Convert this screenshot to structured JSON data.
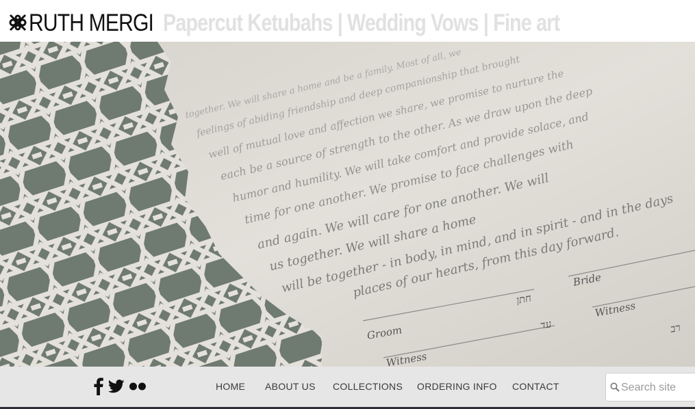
{
  "header": {
    "brand": "RUTH MERGI",
    "tagline": "Papercut Ketubahs | Wedding Vows | Fine art",
    "logo_icon": "ornament-logo-icon"
  },
  "hero": {
    "image": "papercut-ketubah-photo",
    "labels": {
      "groom": "Groom",
      "bride": "Bride",
      "witness1": "Witness",
      "witness2": "Witness",
      "heb_chatan": "חתן",
      "heb_ed": "עד",
      "heb_rav": "רב"
    },
    "text_lines": [
      "together. We will share a home and be a family. Most of all, we",
      "feelings of abiding friendship and deep companionship that brought",
      "well of mutual love and affection we share, we promise to nurture the",
      "each be a source of strength to the other. As we draw upon the deep",
      "humor and humility. We will take comfort and provide solace, and",
      "time for one another. We promise to face challenges with",
      "and again. We will care for one another. We will",
      "us together. We will share a home",
      "will be together - in body, in mind, and in spirit - and in the days",
      "places of our hearts, from this day forward."
    ]
  },
  "social": {
    "icons": [
      "facebook-icon",
      "twitter-icon",
      "flickr-icon"
    ]
  },
  "nav": {
    "items": [
      "HOME",
      "ABOUT US",
      "COLLECTIONS",
      "ORDERING INFO",
      "CONTACT"
    ]
  },
  "search": {
    "placeholder": "Search site"
  }
}
